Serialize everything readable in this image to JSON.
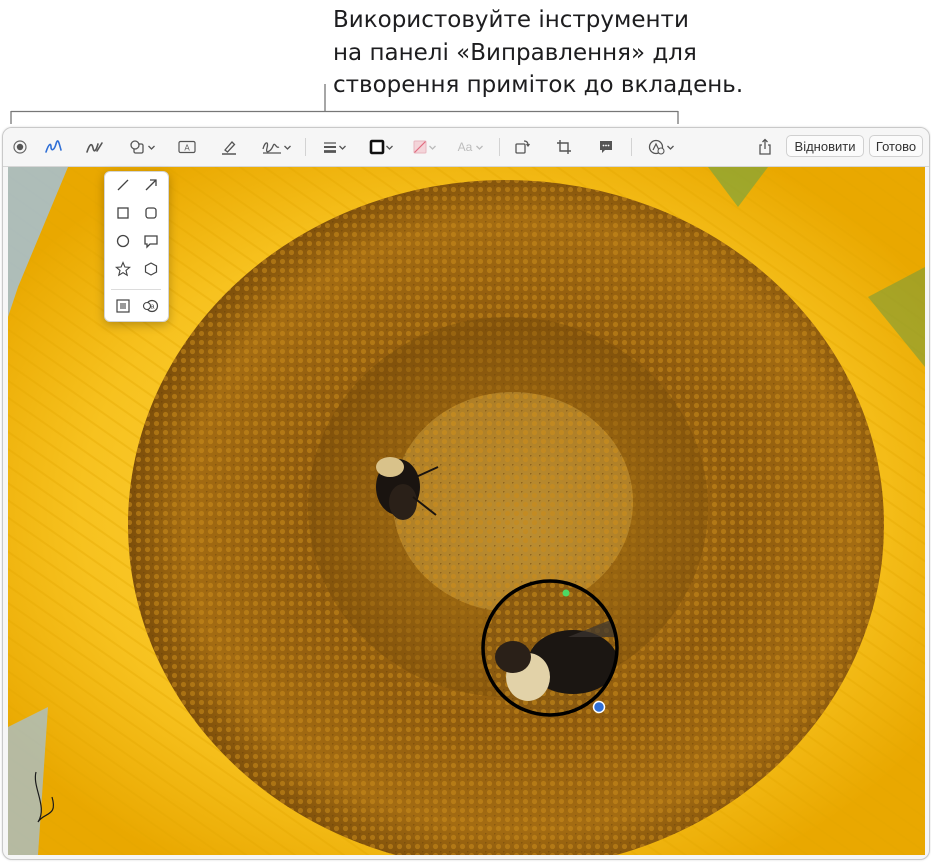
{
  "callout": {
    "lines": [
      "Використовуйте інструменти",
      "на панелі «Виправлення» для",
      "створення приміток до вкладень."
    ]
  },
  "toolbar": {
    "tools": [
      {
        "name": "record-button",
        "icon": "record-dot-icon"
      },
      {
        "name": "sketch-tool",
        "icon": "sketch-icon",
        "active": true
      },
      {
        "name": "draw-tool",
        "icon": "draw-icon"
      },
      {
        "name": "shapes-tool",
        "icon": "shapes-icon",
        "dropdown": true
      },
      {
        "name": "text-tool",
        "icon": "text-box-icon"
      },
      {
        "name": "highlight-tool",
        "icon": "highlighter-icon"
      },
      {
        "name": "signature-tool",
        "icon": "signature-icon",
        "dropdown": true
      },
      {
        "name": "shape-style-tool",
        "icon": "line-weight-icon",
        "dropdown": true
      },
      {
        "name": "border-color-tool",
        "icon": "border-color-icon",
        "dropdown": true
      },
      {
        "name": "fill-color-tool",
        "icon": "fill-color-icon",
        "dropdown": true
      },
      {
        "name": "text-style-tool",
        "icon": "text-style-icon",
        "label": "Aa",
        "dropdown": true
      },
      {
        "name": "rotate-tool",
        "icon": "rotate-icon"
      },
      {
        "name": "crop-tool",
        "icon": "crop-icon"
      },
      {
        "name": "description-tool",
        "icon": "speech-bubble-icon"
      },
      {
        "name": "markup-extras-tool",
        "icon": "markup-circle-icon",
        "dropdown": true
      },
      {
        "name": "share-button",
        "icon": "share-icon"
      }
    ],
    "revert_label": "Відновити",
    "done_label": "Готово",
    "accent_color": "#2f6fd6"
  },
  "shape_menu": {
    "items": [
      "line-icon",
      "arrow-icon",
      "rectangle-icon",
      "rounded-rectangle-icon",
      "oval-icon",
      "speech-balloon-icon",
      "star-icon",
      "hexagon-icon",
      "mask-icon",
      "loupe-icon"
    ]
  },
  "photo": {
    "subject": "sunflower with bees",
    "loupe_handle_colors": [
      "#4cd964",
      "#2f6fd6"
    ]
  }
}
